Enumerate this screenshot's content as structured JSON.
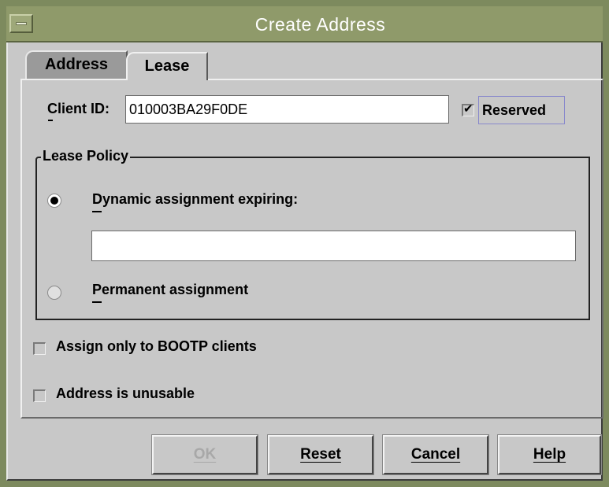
{
  "window": {
    "title": "Create Address"
  },
  "tabs": [
    {
      "label": "Address",
      "selected": false
    },
    {
      "label": "Lease",
      "selected": true
    }
  ],
  "client_id": {
    "label": "Client ID:",
    "value": "010003BA29F0DE"
  },
  "reserved": {
    "label": "Reserved",
    "checked": true
  },
  "lease_policy": {
    "legend": "Lease Policy",
    "dynamic": {
      "label": "Dynamic assignment expiring:",
      "selected": true
    },
    "expiry_value": "",
    "permanent": {
      "label": "Permanent assignment",
      "selected": false
    }
  },
  "options": {
    "bootp_only": {
      "label": "Assign only to BOOTP clients",
      "checked": false
    },
    "unusable": {
      "label": "Address is unusable",
      "checked": false
    }
  },
  "buttons": {
    "ok": {
      "label": "OK",
      "enabled": false
    },
    "reset": {
      "label": "Reset"
    },
    "cancel": {
      "label": "Cancel"
    },
    "help": {
      "label": "Help"
    }
  },
  "colors": {
    "titlebar": "#8f9a6a",
    "window_bg": "#c8c8c8"
  }
}
